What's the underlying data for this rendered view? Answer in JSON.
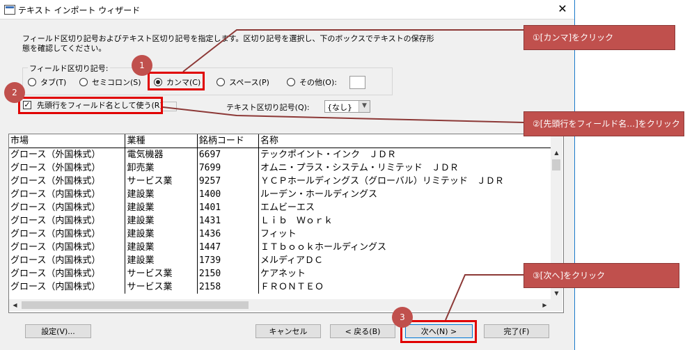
{
  "window": {
    "title": "テキスト インポート ウィザード",
    "close_glyph": "✕",
    "instruction": "フィールド区切り記号およびテキスト区切り記号を指定します。区切り記号を選択し、下のボックスでテキストの保存形態を確認してください。"
  },
  "delimiter": {
    "group_label": "フィールド区切り記号:",
    "options": [
      "タブ(T)",
      "セミコロン(S)",
      "カンマ(C)",
      "スペース(P)",
      "その他(O):"
    ],
    "selected": "カンマ(C)",
    "other_value": ""
  },
  "first_row": {
    "label": "先頭行をフィールド名として使う(R)",
    "checked": true,
    "check_glyph": "✓"
  },
  "text_qualifier": {
    "label": "テキスト区切り記号(Q):",
    "value": "{なし}"
  },
  "table": {
    "headers": [
      "市場",
      "業種",
      "銘柄コード",
      "名称"
    ],
    "rows": [
      [
        "グロース（外国株式）",
        "電気機器",
        "6697",
        "テックポイント・インク　ＪＤＲ"
      ],
      [
        "グロース（外国株式）",
        "卸売業",
        "7699",
        "オムニ・プラス・システム・リミテッド　ＪＤＲ"
      ],
      [
        "グロース（外国株式）",
        "サービス業",
        "9257",
        "ＹＣＰホールディングス（グローバル）リミテッド　ＪＤＲ"
      ],
      [
        "グロース（内国株式）",
        "建設業",
        "1400",
        "ルーデン・ホールディングス"
      ],
      [
        "グロース（内国株式）",
        "建設業",
        "1401",
        "エムビーエス"
      ],
      [
        "グロース（内国株式）",
        "建設業",
        "1431",
        "Ｌｉｂ　Ｗｏｒｋ"
      ],
      [
        "グロース（内国株式）",
        "建設業",
        "1436",
        "フィット"
      ],
      [
        "グロース（内国株式）",
        "建設業",
        "1447",
        "ＩＴｂｏｏｋホールディングス"
      ],
      [
        "グロース（内国株式）",
        "建設業",
        "1739",
        "メルディアＤＣ"
      ],
      [
        "グロース（内国株式）",
        "サービス業",
        "2150",
        "ケアネット"
      ],
      [
        "グロース（内国株式）",
        "サービス業",
        "2158",
        "ＦＲＯＮＴＥＯ"
      ]
    ]
  },
  "scroll_glyphs": {
    "up": "▲",
    "down": "▼",
    "left": "◀",
    "right": "▶"
  },
  "buttons": {
    "settings": "設定(V)...",
    "cancel": "キャンセル",
    "back": "< 戻る(B)",
    "next": "次へ(N) >",
    "finish": "完了(F)"
  },
  "callouts": {
    "c1": "①[カンマ]をクリック",
    "c2": "②[先頭行をフィールド名…]をクリック",
    "c3": "③[次へ]をクリック"
  },
  "steps": {
    "s1": "1",
    "s2": "2",
    "s3": "3"
  },
  "colors": {
    "accent": "#c0504d",
    "highlight": "#e00000",
    "default_button": "#0078d7"
  }
}
